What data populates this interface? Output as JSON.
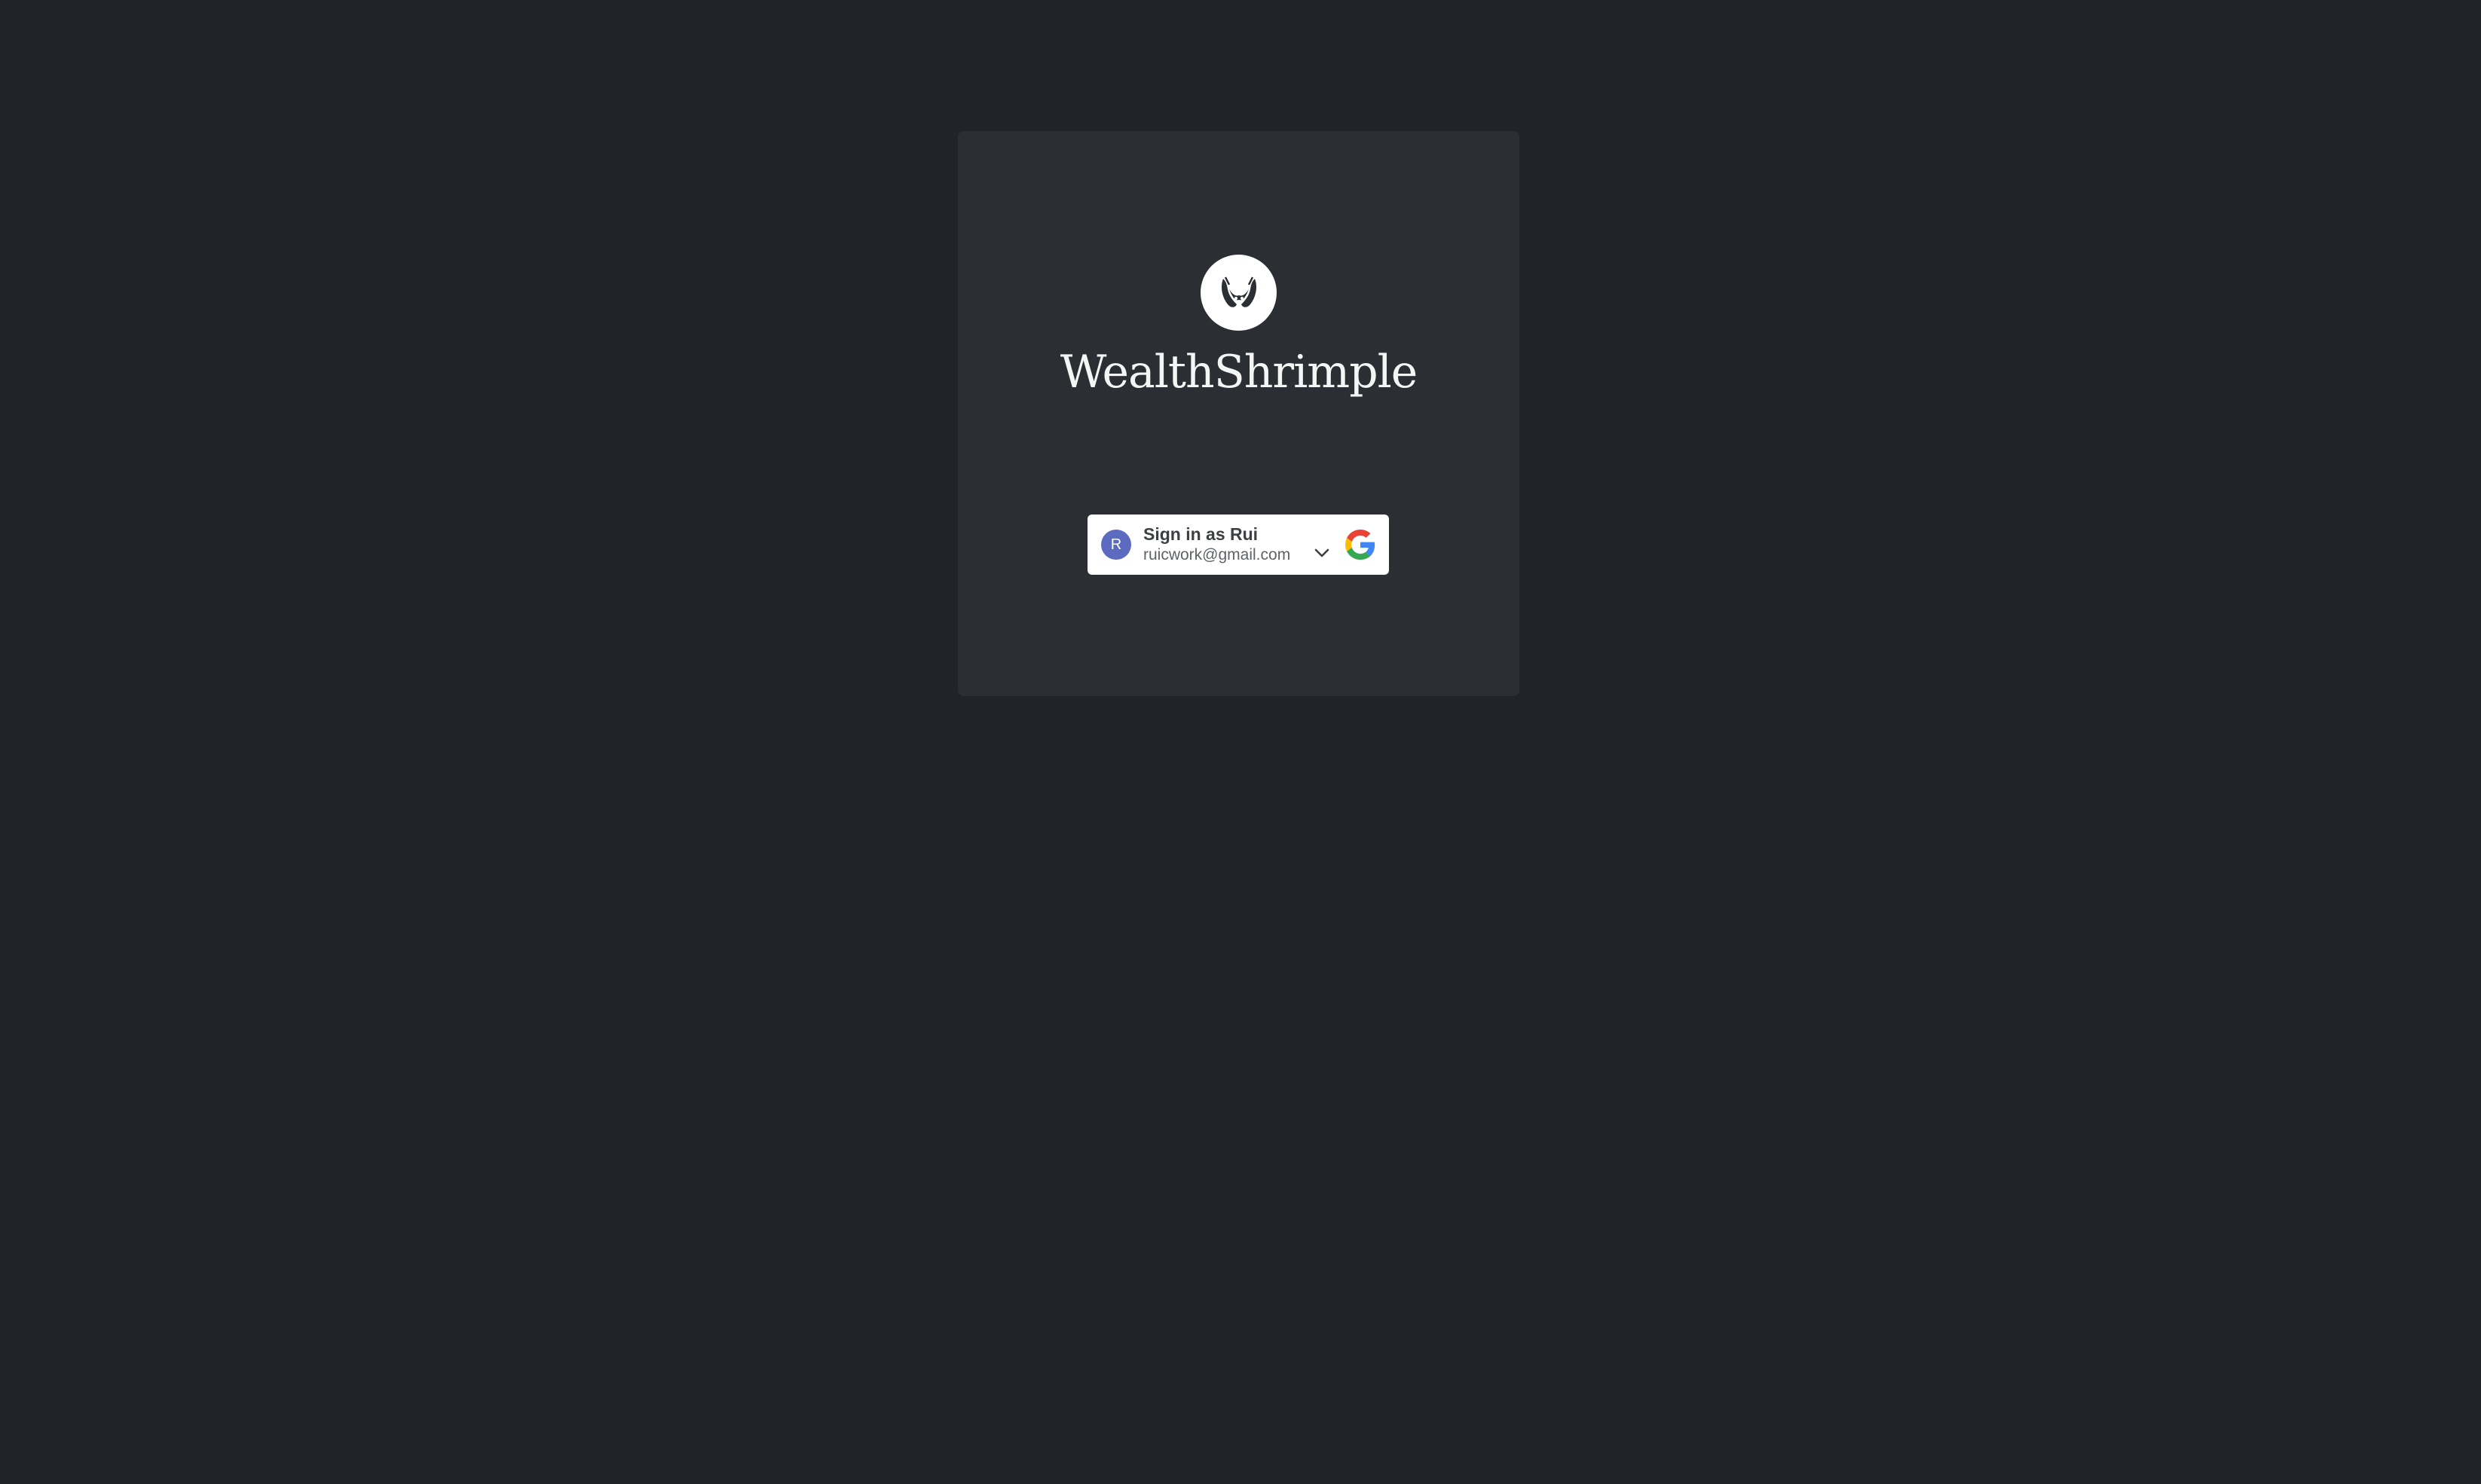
{
  "brand": {
    "name": "WealthShrimple",
    "logo_icon": "shrimp-logo-icon"
  },
  "google_signin": {
    "title": "Sign in as Rui",
    "email": "ruicwork@gmail.com",
    "avatar_initial": "R",
    "avatar_color": "#5c6bc0",
    "chevron_icon": "chevron-down-icon",
    "provider_icon": "google-g-icon"
  },
  "colors": {
    "background": "#212328",
    "card": "#2b2e33",
    "brand_text": "#f5f5f5"
  }
}
